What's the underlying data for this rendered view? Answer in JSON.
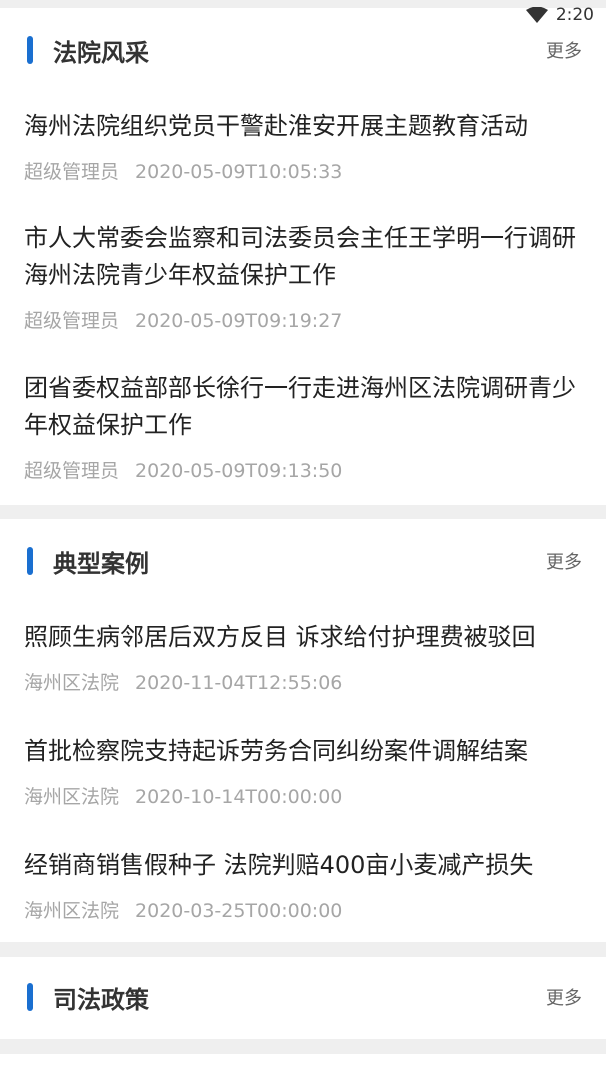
{
  "status_bar": {
    "time": "2:20"
  },
  "sections": [
    {
      "title": "法院风采",
      "more": "更多",
      "items": [
        {
          "title": "海州法院组织党员干警赴淮安开展主题教育活动",
          "author": "超级管理员",
          "date": "2020-05-09T10:05:33"
        },
        {
          "title": "市人大常委会监察和司法委员会主任王学明一行调研海州法院青少年权益保护工作",
          "author": "超级管理员",
          "date": "2020-05-09T09:19:27"
        },
        {
          "title": "团省委权益部部长徐行一行走进海州区法院调研青少年权益保护工作",
          "author": "超级管理员",
          "date": "2020-05-09T09:13:50"
        }
      ]
    },
    {
      "title": "典型案例",
      "more": "更多",
      "items": [
        {
          "title": "照顾生病邻居后双方反目 诉求给付护理费被驳回",
          "author": "海州区法院",
          "date": "2020-11-04T12:55:06"
        },
        {
          "title": "首批检察院支持起诉劳务合同纠纷案件调解结案",
          "author": "海州区法院",
          "date": "2020-10-14T00:00:00"
        },
        {
          "title": "经销商销售假种子 法院判赔400亩小麦减产损失",
          "author": "海州区法院",
          "date": "2020-03-25T00:00:00"
        }
      ]
    },
    {
      "title": "司法政策",
      "more": "更多",
      "items": []
    }
  ]
}
